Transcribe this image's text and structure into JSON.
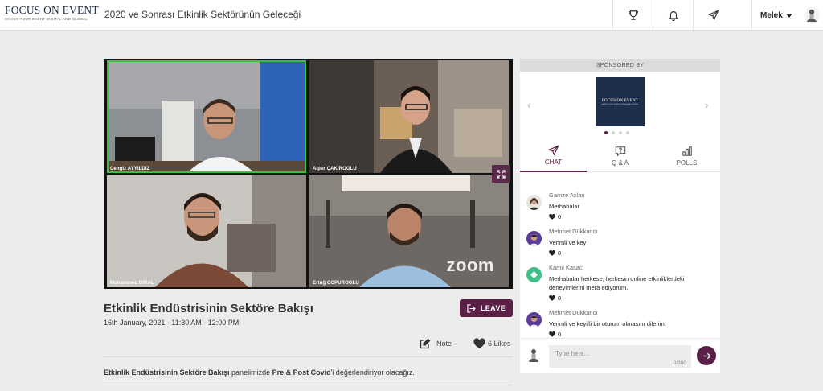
{
  "header": {
    "logo_main": "FOCUS ON EVENT",
    "logo_sub": "MAKES YOUR EVENT DIGITAL AND GLOBAL",
    "page_title": "2020 ve Sonrası Etkinlik Sektörünün Geleceği",
    "nav_icons": [
      "trophy-icon",
      "bell-icon",
      "send-icon"
    ],
    "user_name": "Melek"
  },
  "video": {
    "participants": [
      {
        "name": "Cengiz AYYILDIZ",
        "active_speaker": true
      },
      {
        "name": "Alper ÇAKIROGLU",
        "active_speaker": false
      },
      {
        "name": "Muhammed BİRAL",
        "active_speaker": false
      },
      {
        "name": "Ertuğ COPUROGLU",
        "active_speaker": false
      }
    ],
    "watermark": "zoom"
  },
  "session": {
    "title": "Etkinlik Endüstrisinin Sektöre Bakışı",
    "date": "16th January, 2021 - 11:30 AM - 12:00 PM",
    "leave_label": "LEAVE",
    "note_label": "Note",
    "likes_label": "6 Likes",
    "description": {
      "part1": "Etkinlik Endüstrisinin Sektöre Bakışı",
      "part2": " panelimizde ",
      "part3": "Pre & Post Covid",
      "part4": "'i değerlendiriyor olacağız."
    }
  },
  "sidebar": {
    "sponsor_heading": "SPONSORED BY",
    "sponsor_logo_text": "FOCUS ON EVENT",
    "sponsor_logo_sub": "MAKES YOUR EVENT DIGITAL AND GLOBAL",
    "arrow_left": "‹",
    "arrow_right": "›",
    "tabs": [
      {
        "label": "CHAT",
        "icon": "send-icon",
        "active": true
      },
      {
        "label": "Q & A",
        "icon": "question-icon",
        "active": false
      },
      {
        "label": "POLLS",
        "icon": "bar-chart-icon",
        "active": false
      }
    ],
    "messages": [
      {
        "name": "Gamze Aslan",
        "text": "Merhabalar",
        "likes": "0"
      },
      {
        "name": "Mehmet Dükkancı",
        "text": "Verimli ve key",
        "likes": "0"
      },
      {
        "name": "Kamil Kasacı",
        "text": "Merhabalar herkese, herkesin online etkinliklerdeki deneyimlerini mera ediyorum.",
        "likes": "0"
      },
      {
        "name": "Mehmet Dükkancı",
        "text": "Verimli ve keyifli bir oturum olmasını dilerim.",
        "likes": "0"
      }
    ],
    "input_placeholder": "Type here...",
    "char_count": "0/300",
    "colors": {
      "accent": "#5a1f45",
      "active_speaker": "#3fbd3f"
    }
  }
}
